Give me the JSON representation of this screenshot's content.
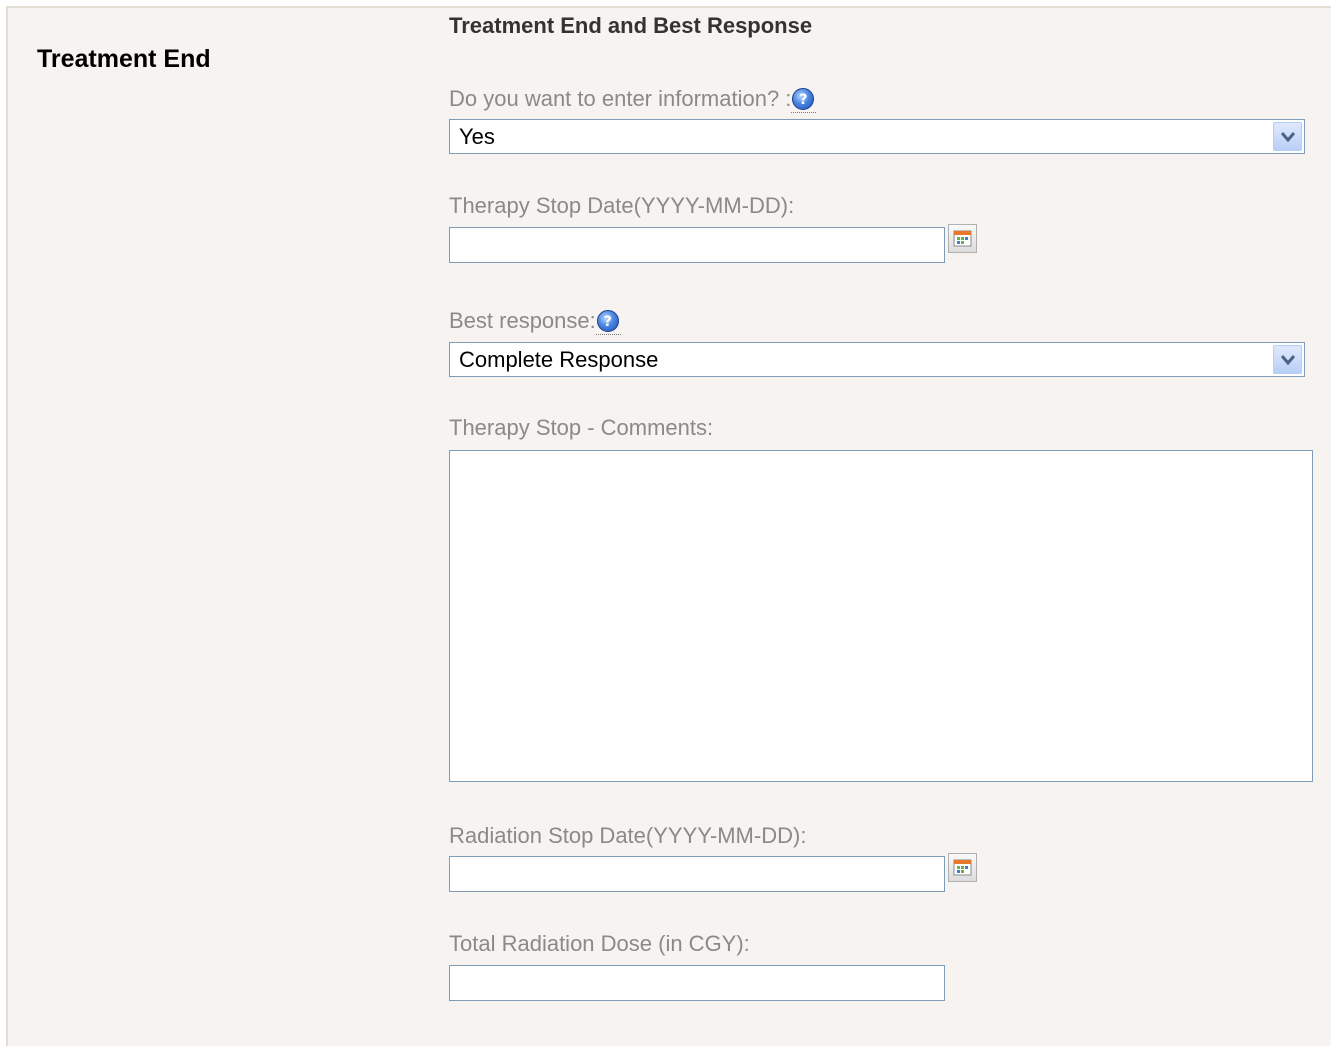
{
  "section": {
    "title": "Treatment End"
  },
  "form": {
    "title": "Treatment End and Best Response",
    "enter_info": {
      "label": "Do you want to enter information? :",
      "value": "Yes"
    },
    "therapy_stop_date": {
      "label": "Therapy Stop Date(YYYY-MM-DD):",
      "value": ""
    },
    "best_response": {
      "label": "Best response:",
      "value": "Complete Response"
    },
    "therapy_stop_comments": {
      "label": "Therapy Stop - Comments:",
      "value": ""
    },
    "radiation_stop_date": {
      "label": "Radiation Stop Date(YYYY-MM-DD):",
      "value": ""
    },
    "total_radiation_dose": {
      "label": "Total Radiation Dose (in CGY):",
      "value": ""
    }
  },
  "icons": {
    "help": "help-icon",
    "calendar": "calendar-icon",
    "dropdown": "chevron-down-icon"
  },
  "colors": {
    "panel_background": "#f6f3f0",
    "label_text": "#8a8a8a",
    "input_border": "#7f9db9"
  }
}
